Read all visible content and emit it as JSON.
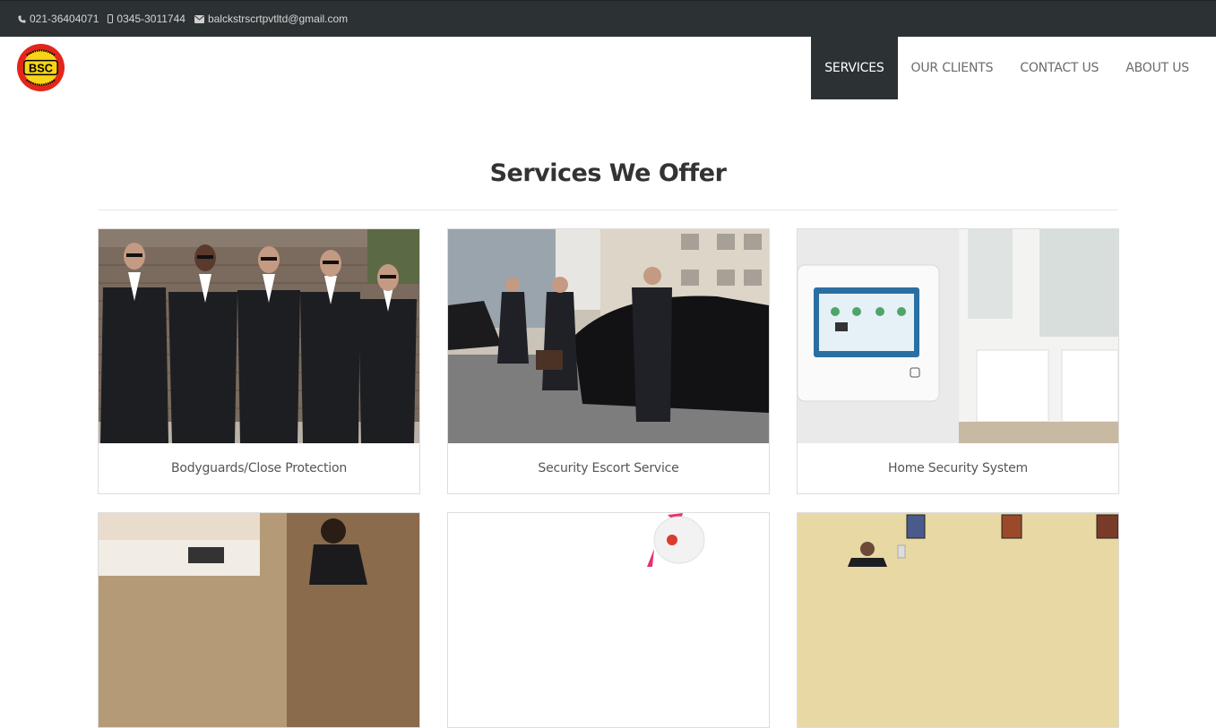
{
  "topbar": {
    "phone": "021-36404071",
    "mobile": "0345-3011744",
    "email": "balckstrscrtpvtltd@gmail.com"
  },
  "logo": {
    "text": "BSC",
    "ring_top": "BLACKSTAR",
    "ring_bottom": "SECURITY"
  },
  "nav": [
    {
      "label": "SERVICES",
      "active": true
    },
    {
      "label": "OUR CLIENTS",
      "active": false
    },
    {
      "label": "CONTACT US",
      "active": false
    },
    {
      "label": "ABOUT US",
      "active": false
    }
  ],
  "section": {
    "title": "Services We Offer"
  },
  "services": [
    {
      "caption": "Bodyguards/Close Protection",
      "image": "bodyguards-photo"
    },
    {
      "caption": "Security Escort Service",
      "image": "escort-photo"
    },
    {
      "caption": "Home Security System",
      "image": "alarm-panel-photo"
    },
    {
      "caption": "",
      "image": "reception-guard-photo"
    },
    {
      "caption": "",
      "image": "camera-photo"
    },
    {
      "caption": "",
      "image": "office-guard-photo"
    }
  ],
  "colors": {
    "dark": "#2c3234",
    "logo_red": "#e3261c",
    "logo_yellow": "#f7d417"
  }
}
